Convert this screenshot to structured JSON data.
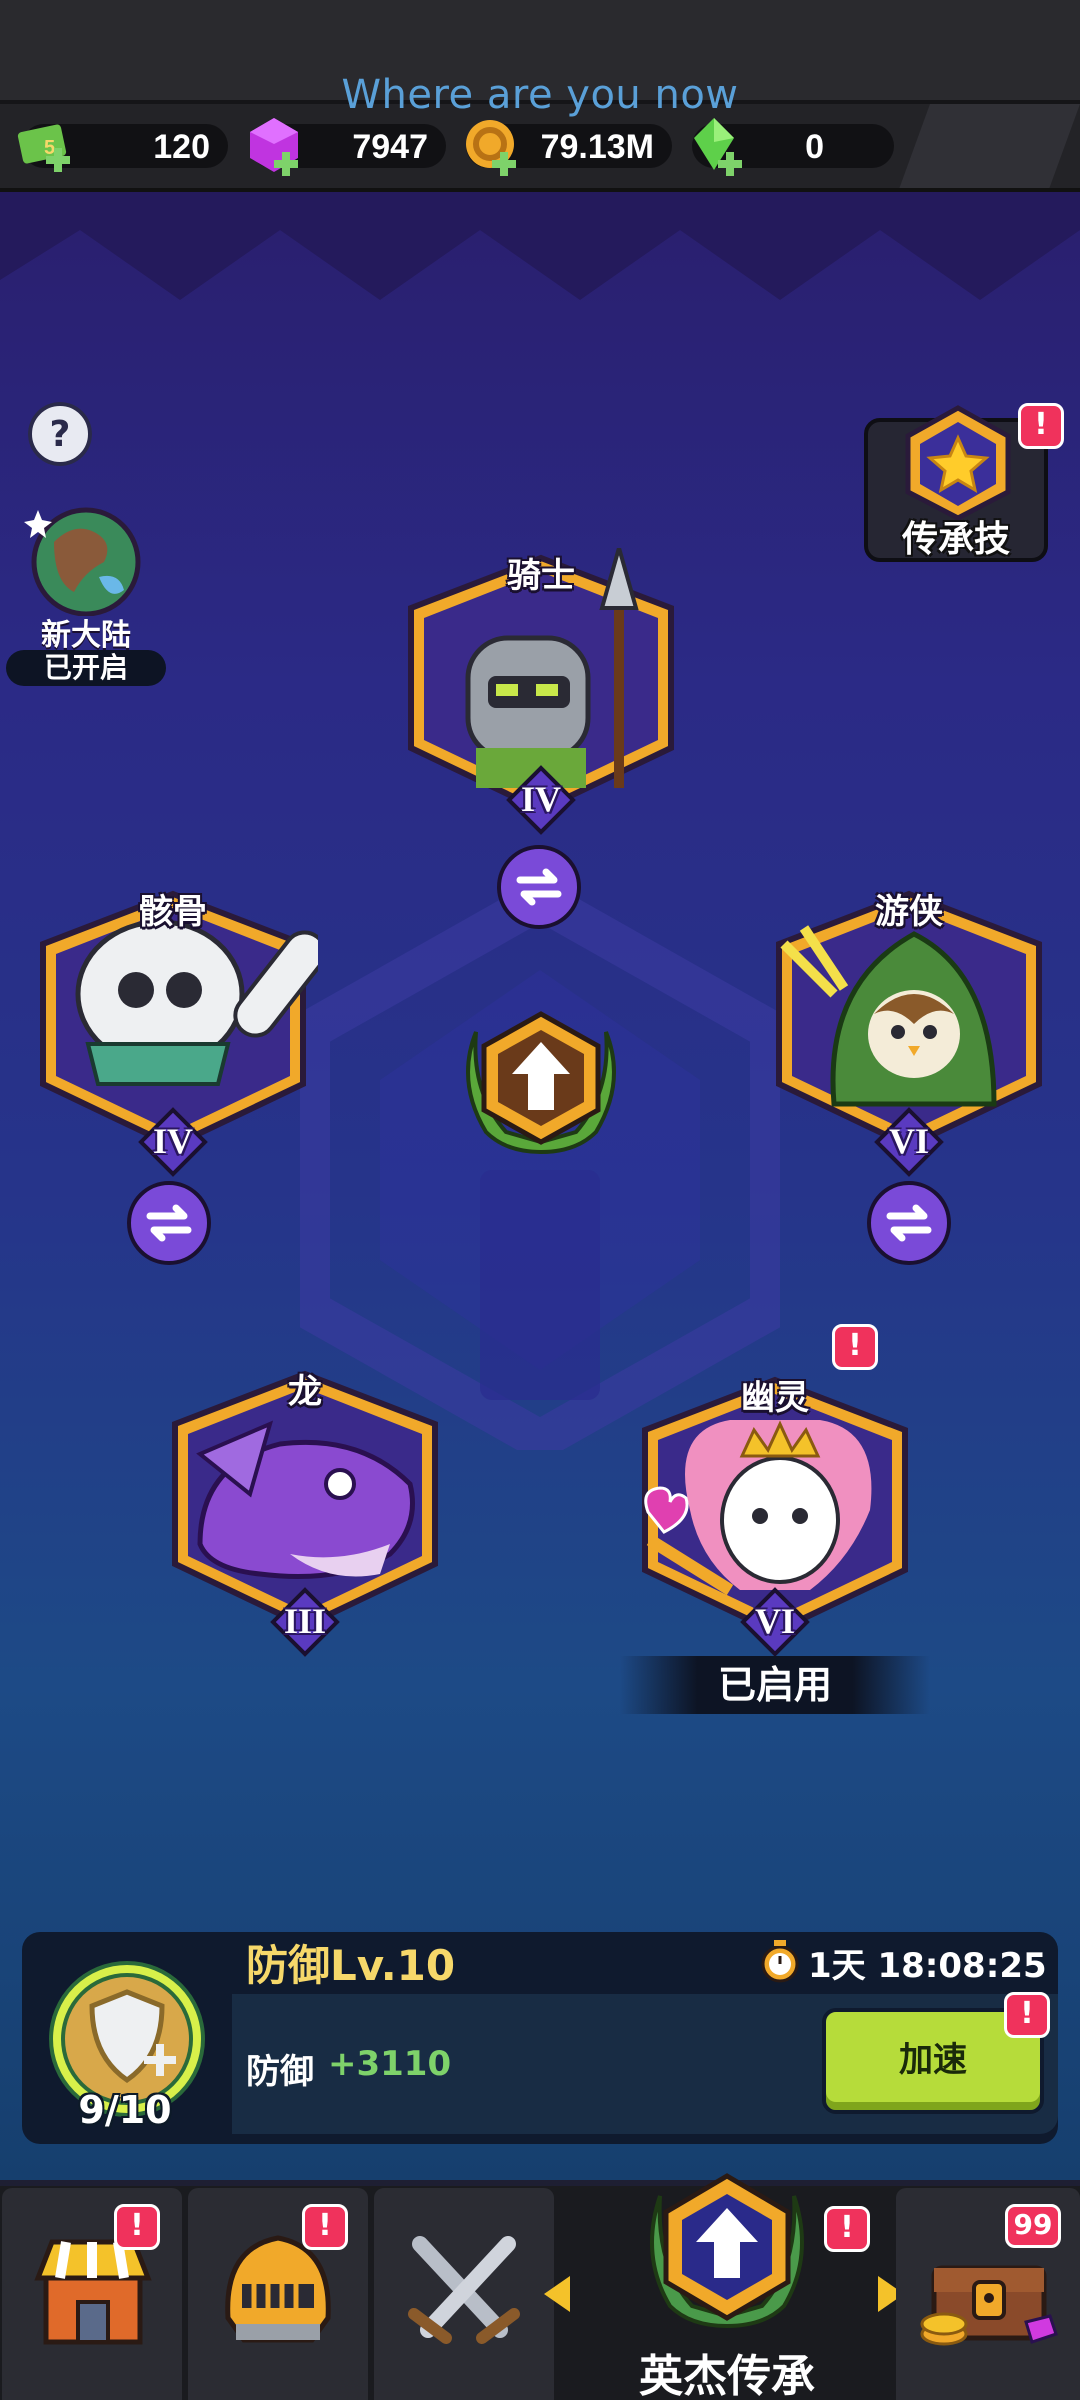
{
  "hint_text": "Where are you now",
  "resources": [
    {
      "name": "tickets",
      "icon": "ticket-plus-icon",
      "value": "120"
    },
    {
      "name": "gems",
      "icon": "purple-gem-plus-icon",
      "value": "7947"
    },
    {
      "name": "gold",
      "icon": "gold-coin-plus-icon",
      "value": "79.13M"
    },
    {
      "name": "crystals",
      "icon": "green-crystal-plus-icon",
      "value": "0"
    }
  ],
  "left_side": {
    "help_icon": "question-icon",
    "continent_label": "新大陆",
    "continent_status": "已开启"
  },
  "legacy_skill": {
    "label": "传承技",
    "alert": "!"
  },
  "heroes": [
    {
      "id": "knight",
      "name": "骑士",
      "rank": "IV",
      "has_swap": true
    },
    {
      "id": "skeleton",
      "name": "骸骨",
      "rank": "IV",
      "has_swap": true
    },
    {
      "id": "ranger",
      "name": "游侠",
      "rank": "VI",
      "has_swap": true
    },
    {
      "id": "dragon",
      "name": "龙",
      "rank": "III",
      "has_swap": false
    },
    {
      "id": "ghost",
      "name": "幽灵",
      "rank": "VI",
      "has_swap": false,
      "status": "已启用",
      "alert": "!"
    }
  ],
  "upgrade_panel": {
    "title": "防御Lv.10",
    "timer": "1天 18:08:25",
    "stat_label": "防御",
    "stat_value": "+3110",
    "progress_text": "9/10",
    "speed_label": "加速",
    "alert": "!"
  },
  "bottom_nav": {
    "active_label": "英杰传承",
    "badge_count": "99",
    "alert": "!"
  },
  "colors": {
    "gold_frame": "#f1a92a",
    "hex_purple": "#3a2a8a",
    "alert_red": "#f0325c",
    "speed_green": "#b6dc3a",
    "hint_blue": "#5aa0d8"
  }
}
